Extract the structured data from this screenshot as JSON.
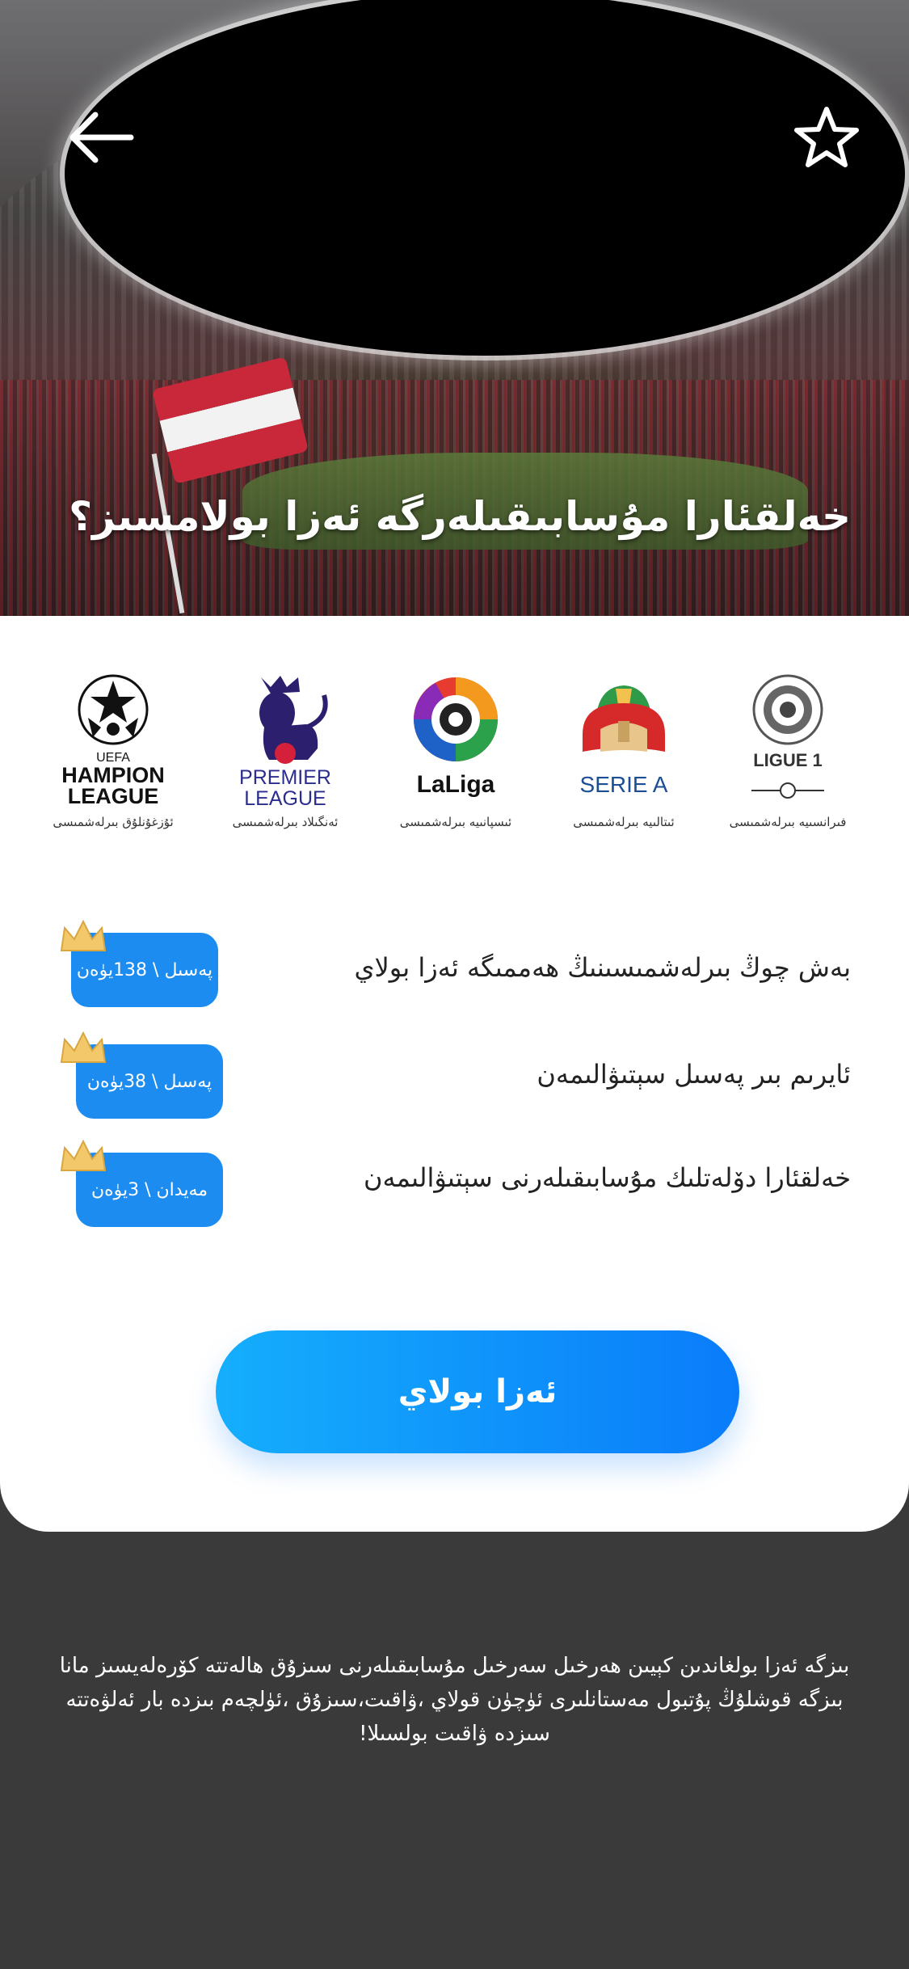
{
  "hero": {
    "title": "خەلقئارا مۇسابىقىلەرگە ئەزا بولامسىز؟",
    "back_icon": "arrow-left-icon",
    "favorite_icon": "star-outline-icon"
  },
  "leagues": [
    {
      "logo_text": "LIGUE 1",
      "name": "فىرانسىيە بىرلەشمىسى"
    },
    {
      "logo_text": "SERIE A",
      "name": "ئىتالىيە بىرلەشمىسى"
    },
    {
      "logo_text": "LaLiga",
      "name": "ئىسپانىيە بىرلەشمىسى"
    },
    {
      "logo_text_1": "PREMIER",
      "logo_text_2": "LEAGUE",
      "name": "ئەنگىلاد بىرلەشمىسى"
    },
    {
      "logo_text_1": "UEFA",
      "logo_text_2": "HAMPION",
      "logo_text_3": "LEAGUE",
      "name": "ئۇزغۇنلۇق بىرلەشمىسى"
    }
  ],
  "benefits": [
    {
      "text": "بەش چوڭ بىرلەشمىسىنىڭ ھەممىگە ئەزا بولاي",
      "price": "پەسىل \\ 138يۈەن"
    },
    {
      "text": "ئايرىم بىر پەسىل سېتىۋالىمەن",
      "price": "پەسىل \\ 38يۈەن"
    },
    {
      "text": "خەلقئارا دۆلەتلىك مۇسابىقىلەرنى سېتىۋالىمەن",
      "price": "مەيدان \\ 3يۈەن"
    }
  ],
  "join_button": "ئەزا بولاي",
  "footer_text": "بىزگە ئەزا بولغاندىن كېيىن ھەرخىل سەرخىل مۇسابىقىلەرنى سىزۇق ھالەتتە كۆرەلەيسىز مانا بىزگە قوشلۇڭ پۇتبول مەستانلىرى ئۈچۈن قولاي ،ۋاقىت،سىزۇق ،ئۈلچەم بىزدە بار ئەلۋەتتە سىزدە ۋاقىت بولسىلا!",
  "colors": {
    "accent": "#1c8cf0",
    "button_start": "#15aefc",
    "button_end": "#0a7cfa",
    "footer_bg": "#3a3a3a",
    "crown": "#f3c86a"
  }
}
